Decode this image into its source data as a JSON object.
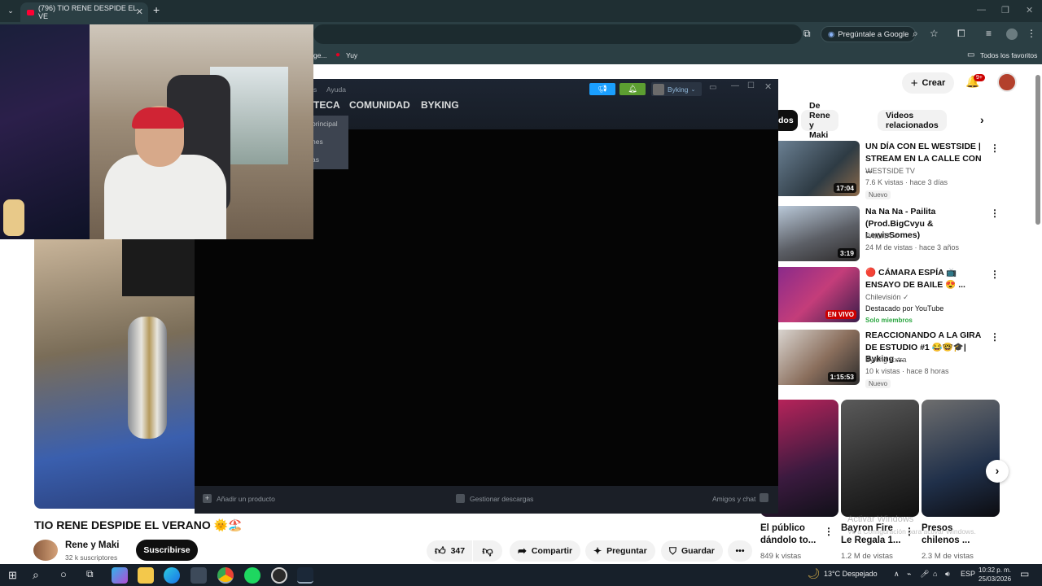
{
  "browser": {
    "tab_counter_title": "(796) TIO RENE DESPIDE EL VE",
    "ask_google": "Pregúntale a Google",
    "bookmarks": {
      "item1": "ge...",
      "item2": "Yuy",
      "all_favorites": "Todos los favoritos"
    }
  },
  "youtube": {
    "create_label": "Crear",
    "notif_badge": "9+",
    "chips": [
      "dos",
      "De Rene y Maki",
      "Videos relacionados"
    ],
    "video": {
      "title": "TIO RENE DESPIDE EL VERANO 🌞🏖️",
      "channel": "Rene y Maki",
      "subscribers": "32 k suscriptores",
      "subscribe_label": "Suscribirse",
      "likes": "347",
      "share": "Compartir",
      "ask": "Preguntar",
      "save": "Guardar"
    },
    "recommendations": [
      {
        "title": "UN DÍA CON EL WESTSIDE | STREAM EN LA CALLE CON ...",
        "channel": "WESTSIDE TV",
        "meta": "7.6 K vistas · hace 3 días",
        "badge": "Nuevo",
        "duration": "17:04"
      },
      {
        "title": "Na Na Na - Pailita (Prod.BigCvyu & LewisSomes)",
        "channel": "PAILITA ✓",
        "meta": "24 M de vistas · hace 3 años",
        "duration": "3:19"
      },
      {
        "title": "🔴 CÁMARA ESPÍA 📺 ENSAYO DE BAILE 😍 ...",
        "channel": "Chilevisión ✓",
        "meta": "Destacado por YouTube",
        "badge": "Solo miembros",
        "duration": "EN VIVO"
      },
      {
        "title": "REACCIONANDO A LA GIRA DE ESTUDIO #1 😂🤓🎓| Byking ...",
        "channel": "Byking Extra",
        "meta": "10 k vistas · hace 8 horas",
        "badge": "Nuevo",
        "duration": "1:15:53"
      }
    ],
    "shorts": [
      {
        "title": "El público dándolo to...",
        "views": "849 k vistas"
      },
      {
        "title": "Bayron Fire Le Regala 1...",
        "views": "1.2 M de vistas"
      },
      {
        "title": "Presos chilenos ...",
        "views": "2.3 M de vistas"
      }
    ]
  },
  "steam": {
    "menu_fragment": "s",
    "help": "Ayuda",
    "nav": [
      "TECA",
      "COMUNIDAD",
      "BYKING"
    ],
    "username": "Byking",
    "dropdown": [
      "principal",
      "nes",
      "as"
    ],
    "add_product": "Añadir un producto",
    "manage_downloads": "Gestionar descargas",
    "friends_chat": "Amigos y chat"
  },
  "windows": {
    "watermark": "Activar Windows",
    "watermark_sub": "Ve a Configuración para activar Windows.",
    "weather": "13°C  Despejado",
    "lang": "ESP",
    "time": "10:32 p. m.",
    "date": "25/03/2026"
  },
  "colors": {
    "accent_red": "#ff0033",
    "steam_blue": "#1a9fff",
    "steam_green": "#5c9e31"
  }
}
